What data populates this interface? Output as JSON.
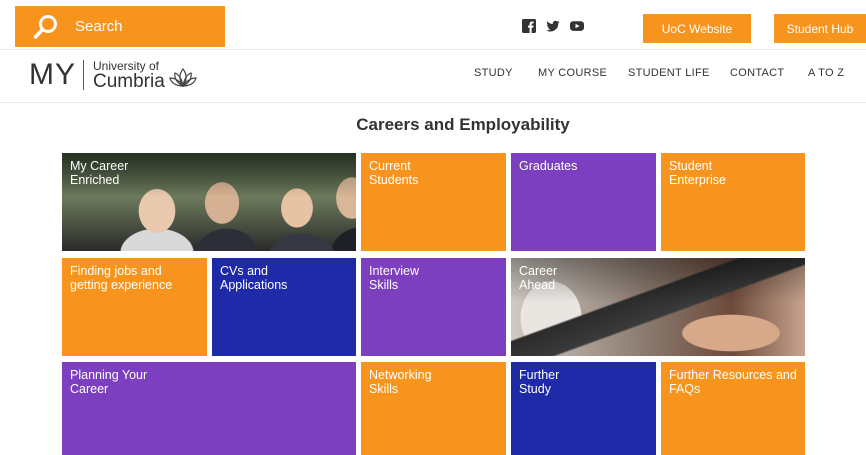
{
  "header": {
    "search_label": "Search",
    "social_icons": [
      "facebook-icon",
      "twitter-icon",
      "youtube-icon"
    ],
    "uoc_button": "UoC Website",
    "hub_button": "Student Hub"
  },
  "logo": {
    "my": "MY",
    "line1": "University of",
    "line2": "Cumbria"
  },
  "nav": {
    "items": [
      "STUDY",
      "MY COURSE",
      "STUDENT LIFE",
      "CONTACT",
      "A TO Z"
    ]
  },
  "page": {
    "title": "Careers and Employability"
  },
  "tiles": [
    {
      "label": "My Career\nEnriched"
    },
    {
      "label": "Current\nStudents"
    },
    {
      "label": "Graduates"
    },
    {
      "label": "Student\nEnterprise"
    },
    {
      "label": "Finding jobs and\ngetting experience"
    },
    {
      "label": "CVs and\nApplications"
    },
    {
      "label": "Interview\nSkills"
    },
    {
      "label": "Career\nAhead"
    },
    {
      "label": "Planning Your\nCareer"
    },
    {
      "label": "Networking\nSkills"
    },
    {
      "label": "Further\nStudy"
    },
    {
      "label": "Further Resources and\nFAQs"
    }
  ],
  "colors": {
    "orange": "#f7941d",
    "purple": "#7b3fbf",
    "blue": "#1f2aa8"
  }
}
